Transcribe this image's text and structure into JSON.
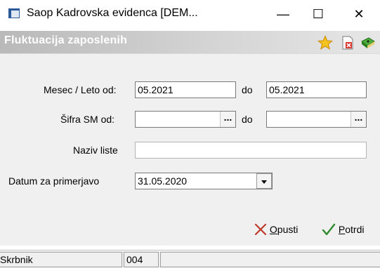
{
  "window": {
    "title": "Saop Kadrovska evidenca [DEM...",
    "minimize": "—",
    "maximize": "☐",
    "close": "✕"
  },
  "header": {
    "title": "Fluktuacija zaposlenih",
    "icons": [
      "star-icon",
      "delete-document-icon",
      "help-book-icon"
    ]
  },
  "form": {
    "period_from_label": "Mesec / Leto od:",
    "period_from_value": "05.2021",
    "period_to_label": "do",
    "period_to_value": "05.2021",
    "sm_from_label": "Šifra SM od:",
    "sm_from_value": "",
    "sm_to_label": "do",
    "sm_to_value": "",
    "dots": "...",
    "list_name_label": "Naziv liste",
    "list_name_value": "",
    "compare_date_label": "Datum za primerjavo",
    "compare_date_value": "31.05.2020"
  },
  "actions": {
    "cancel_u": "O",
    "cancel_rest": "pusti",
    "confirm_u": "P",
    "confirm_rest": "otrdi"
  },
  "status": {
    "user": "Skrbnik",
    "code": "004",
    "extra": ""
  },
  "colors": {
    "cancel_x": "#c0392b",
    "confirm_check": "#2e8b2e",
    "banner_text": "#ffffff"
  }
}
